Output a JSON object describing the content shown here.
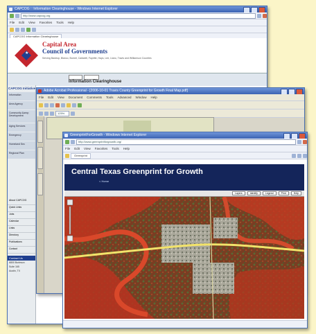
{
  "colors": {
    "page_bg": "#fbf5c8",
    "title_bar": "#3b63b3",
    "logo_red": "#c4262e",
    "logo_blue": "#1f3f8f",
    "map_header": "#14255a"
  },
  "win1": {
    "title": "CAPCOG :: Information Clearinghouse - Windows Internet Explorer",
    "menu": [
      "File",
      "Edit",
      "View",
      "Favorites",
      "Tools",
      "Help"
    ],
    "address": "http://www.capcog.org",
    "tab": "CAPCOG Information Clearinghouse",
    "logo_line1": "Capital Area",
    "logo_line2": "Council of Governments",
    "tagline": "Serving Bastrop, Blanco, Burnet, Caldwell, Fayette, Hays, Lee, Llano, Travis and Williamson Counties",
    "page_heading": "Information Clearinghouse",
    "sidebar_title": "CAPCOG Initiatives",
    "sidebar_items": [
      "Information",
      "Area Agency",
      "Community &amp; Development",
      "Aging Services",
      "Emergency",
      "Homeland Sec",
      "Regional Plan"
    ],
    "sidebar_items2": [
      "About CAPCOG",
      "Quick Links",
      "Jobs",
      "Calendar",
      "Links",
      "Directory",
      "Publications",
      "Contact"
    ],
    "contact_head": "Contact Us",
    "contact_lines": [
      "6800 Burleson",
      "Suite 165",
      "Austin, TX"
    ]
  },
  "win2": {
    "title": "Adobe Acrobat Professional - [2006-10-01 Travis County Greenprint for Growth Final Map.pdf]",
    "menu": [
      "File",
      "Edit",
      "View",
      "Document",
      "Comments",
      "Tools",
      "Advanced",
      "Window",
      "Help"
    ],
    "zoom": "125%"
  },
  "win3": {
    "title": "GreenprintForGrowth - Windows Internet Explorer",
    "menu": [
      "File",
      "Edit",
      "View",
      "Favorites",
      "Tools",
      "Help"
    ],
    "address": "http://www.greenprintforgrowth.org/",
    "tab": "Greenprint",
    "map_title": "Central Texas Greenprint for Growth",
    "map_sublink": "< Home",
    "map_buttons": [
      "Layers",
      "Identify",
      "Legend",
      "Print",
      "Help"
    ]
  }
}
